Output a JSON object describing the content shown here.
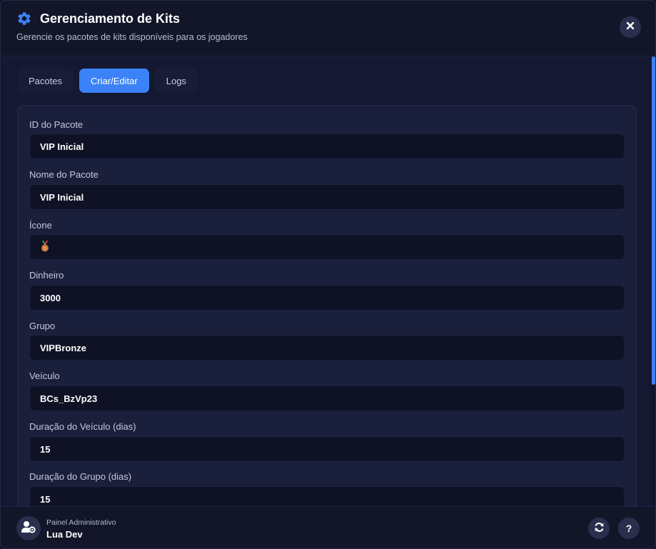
{
  "header": {
    "icon": "gear-icon",
    "title": "Gerenciamento de Kits",
    "subtitle": "Gerencie os pacotes de kits disponíveis para os jogadores",
    "close_icon": "close-icon"
  },
  "tabs": [
    {
      "label": "Pacotes",
      "active": false
    },
    {
      "label": "Criar/Editar",
      "active": true
    },
    {
      "label": "Logs",
      "active": false
    }
  ],
  "form": {
    "fields": [
      {
        "label": "ID do Pacote",
        "value": "VIP Inicial"
      },
      {
        "label": "Nome do Pacote",
        "value": "VIP Inicial"
      },
      {
        "label": "Ícone",
        "value": "🥉",
        "icon": "bronze-medal-icon"
      },
      {
        "label": "Dinheiro",
        "value": "3000"
      },
      {
        "label": "Grupo",
        "value": "VIPBronze"
      },
      {
        "label": "Veículo",
        "value": "BCs_BzVp23"
      },
      {
        "label": "Duração do Veículo (dias)",
        "value": "15"
      },
      {
        "label": "Duração do Grupo (dias)",
        "value": "15"
      }
    ]
  },
  "footer": {
    "avatar_icon": "user-gear-icon",
    "role": "Painel Administrativo",
    "name": "Lua Dev",
    "refresh_icon": "refresh-icon",
    "help_icon": "help-icon",
    "help_label": "?"
  },
  "colors": {
    "accent": "#3b82f6",
    "background": "#141830",
    "panel": "#1a1f3b",
    "input": "#0f1225"
  }
}
